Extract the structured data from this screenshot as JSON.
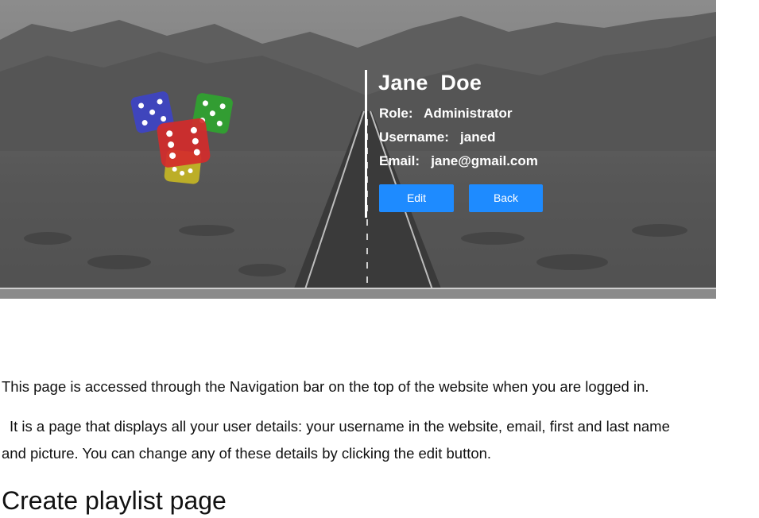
{
  "profile": {
    "name": "Jane  Doe",
    "role_label": "Role:",
    "role_value": "Administrator",
    "username_label": "Username:",
    "username_value": "janed",
    "email_label": "Email:",
    "email_value": "jane@gmail.com",
    "edit_label": "Edit",
    "back_label": "Back",
    "button_color": "#1e8bff"
  },
  "logo": {
    "icon": "dice-icon",
    "colors": [
      "#3d44c8",
      "#2fa52f",
      "#d42b2b",
      "#c8b824"
    ]
  },
  "document": {
    "paragraph_1": "This page is accessed through the Navigation bar on the top of the website when you are logged in.",
    "paragraph_2_line_1": "It is a page that displays all your user details: your username in the website, email, first and last name",
    "paragraph_2_line_2": "and picture. You can change any of these details by clicking the edit button.",
    "heading": "Create playlist page"
  }
}
